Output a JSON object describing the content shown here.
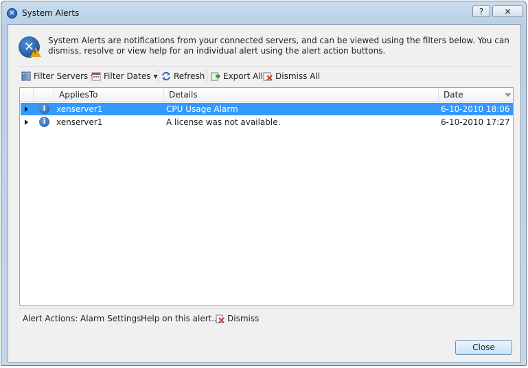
{
  "window": {
    "title": "System Alerts",
    "help_label": "?",
    "close_label": "✕"
  },
  "header": {
    "description": "System Alerts are notifications from your connected servers, and can be viewed using the filters below. You can dismiss, resolve or view help for an individual alert using the alert action buttons."
  },
  "toolbar": {
    "filter_servers": "Filter Servers",
    "filter_dates": "Filter Dates",
    "refresh": "Refresh",
    "export_all": "Export All",
    "dismiss_all": "Dismiss All"
  },
  "grid": {
    "columns": {
      "applies_to": "AppliesTo",
      "details": "Details",
      "date": "Date"
    },
    "rows": [
      {
        "applies_to": "xenserver1",
        "details": "CPU Usage Alarm",
        "date": "6-10-2010 18:06",
        "selected": true
      },
      {
        "applies_to": "xenserver1",
        "details": "A license was not available.",
        "date": "6-10-2010 17:27",
        "selected": false
      }
    ]
  },
  "alert_actions": {
    "label": "Alert Actions:",
    "alarm_settings": "Alarm Settings",
    "help": "Help on this alert...",
    "dismiss": "Dismiss"
  },
  "footer": {
    "close_label": "Close"
  },
  "colors": {
    "selection": "#3399ff",
    "title_gradient": "#b9cfe6"
  }
}
